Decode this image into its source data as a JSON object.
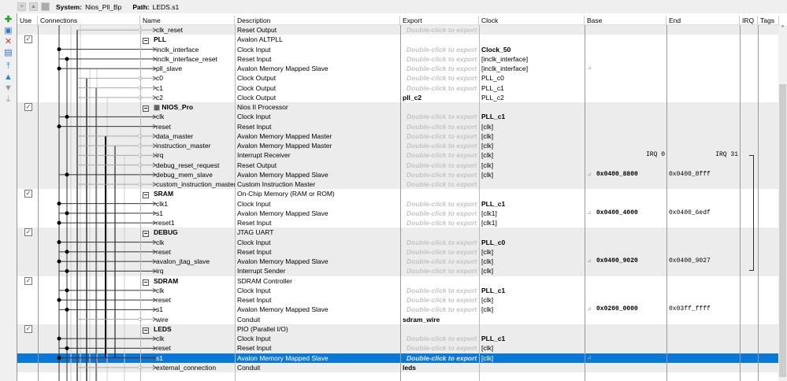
{
  "topbar": {
    "system_label": "System:",
    "system": "Nios_Pll_Bp",
    "path_label": "Path:",
    "path": "LEDS.s1"
  },
  "headers": [
    "Use",
    "Connections",
    "Name",
    "Description",
    "Export",
    "Clock",
    "Base",
    "End",
    "IRQ",
    "Tags"
  ],
  "placeholder": "Double-click to export",
  "rows": [
    {
      "name": "clk_reset",
      "desc": "Reset Output",
      "export": "",
      "clock": "",
      "g": 1,
      "lvl": 1
    },
    {
      "name": "PLL",
      "desc": "Avalon ALTPLL",
      "head": 1,
      "use": 1,
      "g": 0
    },
    {
      "name": "inclk_interface",
      "desc": "Clock Input",
      "clock": "Clock_50",
      "cb": 1,
      "g": 0,
      "lvl": 1
    },
    {
      "name": "inclk_interface_reset",
      "desc": "Reset Input",
      "clock": "[inclk_interface]",
      "g": 0,
      "lvl": 1
    },
    {
      "name": "pll_slave",
      "desc": "Avalon Memory Mapped Slave",
      "clock": "[inclk_interface]",
      "lock": 1,
      "g": 0,
      "lvl": 1
    },
    {
      "name": "c0",
      "desc": "Clock Output",
      "clock": "PLL_c0",
      "g": 0,
      "lvl": 1
    },
    {
      "name": "c1",
      "desc": "Clock Output",
      "clock": "PLL_c1",
      "g": 0,
      "lvl": 1
    },
    {
      "name": "c2",
      "desc": "Clock Output",
      "export": "pll_c2",
      "clock": "PLL_c2",
      "g": 0,
      "lvl": 1
    },
    {
      "name": "NIOS_Pro",
      "desc": "Nios II Processor",
      "head": 1,
      "use": 1,
      "g": 1,
      "cpu": 1
    },
    {
      "name": "clk",
      "desc": "Clock Input",
      "clock": "PLL_c1",
      "cb": 1,
      "g": 1,
      "lvl": 1
    },
    {
      "name": "reset",
      "desc": "Reset Input",
      "clock": "[clk]",
      "g": 1,
      "lvl": 1
    },
    {
      "name": "data_master",
      "desc": "Avalon Memory Mapped Master",
      "clock": "[clk]",
      "g": 1,
      "lvl": 1
    },
    {
      "name": "instruction_master",
      "desc": "Avalon Memory Mapped Master",
      "clock": "[clk]",
      "g": 1,
      "lvl": 1
    },
    {
      "name": "irq",
      "desc": "Interrupt Receiver",
      "clock": "[clk]",
      "irq_a": "IRQ 0",
      "irq_b": "IRQ 31",
      "g": 1,
      "lvl": 1
    },
    {
      "name": "debug_reset_request",
      "desc": "Reset Output",
      "clock": "[clk]",
      "g": 1,
      "lvl": 1
    },
    {
      "name": "debug_mem_slave",
      "desc": "Avalon Memory Mapped Slave",
      "clock": "[clk]",
      "base": "0x0400_8800",
      "end": "0x0400_8fff",
      "lock": 1,
      "g": 1,
      "lvl": 1
    },
    {
      "name": "custom_instruction_master",
      "desc": "Custom Instruction Master",
      "clock": "",
      "g": 1,
      "lvl": 1
    },
    {
      "name": "SRAM",
      "desc": "On-Chip Memory (RAM or ROM)",
      "head": 1,
      "use": 1,
      "g": 0
    },
    {
      "name": "clk1",
      "desc": "Clock Input",
      "clock": "PLL_c1",
      "cb": 1,
      "g": 0,
      "lvl": 1
    },
    {
      "name": "s1",
      "desc": "Avalon Memory Mapped Slave",
      "clock": "[clk1]",
      "base": "0x0400_4000",
      "end": "0x0400_6edf",
      "lock": 1,
      "g": 0,
      "lvl": 1
    },
    {
      "name": "reset1",
      "desc": "Reset Input",
      "clock": "[clk1]",
      "g": 0,
      "lvl": 1
    },
    {
      "name": "DEBUG",
      "desc": "JTAG UART",
      "head": 1,
      "use": 1,
      "g": 1
    },
    {
      "name": "clk",
      "desc": "Clock Input",
      "clock": "PLL_c0",
      "cb": 1,
      "g": 1,
      "lvl": 1
    },
    {
      "name": "reset",
      "desc": "Reset Input",
      "clock": "[clk]",
      "g": 1,
      "lvl": 1
    },
    {
      "name": "avalon_jtag_slave",
      "desc": "Avalon Memory Mapped Slave",
      "clock": "[clk]",
      "base": "0x0400_9020",
      "end": "0x0400_9027",
      "lock": 1,
      "g": 1,
      "lvl": 1
    },
    {
      "name": "irq",
      "desc": "Interrupt Sender",
      "clock": "[clk]",
      "g": 1,
      "lvl": 1
    },
    {
      "name": "SDRAM",
      "desc": "SDRAM Controller",
      "head": 1,
      "use": 1,
      "g": 0
    },
    {
      "name": "clk",
      "desc": "Clock Input",
      "clock": "PLL_c1",
      "cb": 1,
      "g": 0,
      "lvl": 1
    },
    {
      "name": "reset",
      "desc": "Reset Input",
      "clock": "[clk]",
      "g": 0,
      "lvl": 1
    },
    {
      "name": "s1",
      "desc": "Avalon Memory Mapped Slave",
      "clock": "[clk]",
      "base": "0x0200_0000",
      "end": "0x03ff_ffff",
      "lock": 1,
      "g": 0,
      "lvl": 1
    },
    {
      "name": "wire",
      "desc": "Conduit",
      "export": "sdram_wire",
      "g": 0,
      "lvl": 1
    },
    {
      "name": "LEDS",
      "desc": "PIO (Parallel I/O)",
      "head": 1,
      "use": 1,
      "g": 1
    },
    {
      "name": "clk",
      "desc": "Clock Input",
      "clock": "PLL_c1",
      "cb": 1,
      "g": 1,
      "lvl": 1
    },
    {
      "name": "reset",
      "desc": "Reset Input",
      "clock": "[clk]",
      "g": 1,
      "lvl": 1
    },
    {
      "name": "s1",
      "desc": "Avalon Memory Mapped Slave",
      "clock": "[clk]",
      "lock": 1,
      "sel": 1,
      "g": 1,
      "lvl": 1
    },
    {
      "name": "external_connection",
      "desc": "Conduit",
      "export": "leds",
      "g": 1,
      "lvl": 1
    }
  ],
  "colors": {
    "selection": "#0a78d7",
    "group_bg": "#ececec"
  }
}
